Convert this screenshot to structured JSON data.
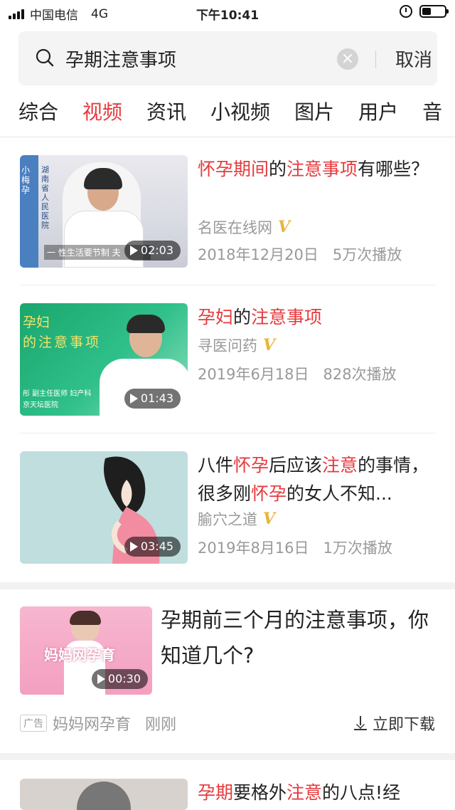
{
  "status_bar": {
    "carrier": "中国电信",
    "network": "4G",
    "time": "下午10:41"
  },
  "search": {
    "query": "孕期注意事项",
    "clear_symbol": "×",
    "cancel_label": "取消"
  },
  "tabs": [
    {
      "label": "综合"
    },
    {
      "label": "视频",
      "active": true
    },
    {
      "label": "资讯"
    },
    {
      "label": "小视频"
    },
    {
      "label": "图片"
    },
    {
      "label": "用户"
    },
    {
      "label": "音"
    }
  ],
  "results": [
    {
      "title_parts": [
        {
          "text": "怀孕期间",
          "hl": true
        },
        {
          "text": "的",
          "hl": false
        },
        {
          "text": "注意事项",
          "hl": true
        },
        {
          "text": "有哪些？",
          "hl": false
        }
      ],
      "source": "名医在线网",
      "verified": "V",
      "date": "2018年12月20日",
      "plays": "5万次播放",
      "duration": "02:03",
      "thumb_caption": "一 性生活要节制 夫",
      "thumb_side_text": "湖南省人民医院",
      "thumb_side_text2": "小梅孕"
    },
    {
      "title_parts": [
        {
          "text": "孕妇",
          "hl": true
        },
        {
          "text": "的",
          "hl": false
        },
        {
          "text": "注意事项",
          "hl": true
        }
      ],
      "source": "寻医问药",
      "verified": "V",
      "date": "2019年6月18日",
      "plays": "828次播放",
      "duration": "01:43",
      "thumb_text_1": "孕妇",
      "thumb_text_2": "的注意事项",
      "thumb_caption": "彤 副主任医师 妇产科",
      "thumb_caption_2": "京天坛医院"
    },
    {
      "title_parts": [
        {
          "text": "八件",
          "hl": false
        },
        {
          "text": "怀孕",
          "hl": true
        },
        {
          "text": "后应该",
          "hl": false
        },
        {
          "text": "注意",
          "hl": true
        },
        {
          "text": "的事情，很多刚",
          "hl": false
        },
        {
          "text": "怀孕",
          "hl": true
        },
        {
          "text": "的女人不知...",
          "hl": false
        }
      ],
      "source": "腧穴之道",
      "verified": "V",
      "date": "2019年8月16日",
      "plays": "1万次播放",
      "duration": "03:45"
    }
  ],
  "ad": {
    "title": "孕期前三个月的注意事项，你知道几个?",
    "duration": "00:30",
    "thumb_text": "妈妈网孕育",
    "tag": "广告",
    "source": "妈妈网孕育",
    "time": "刚刚",
    "download_label": "立即下载"
  },
  "next_result": {
    "title_parts": [
      {
        "text": "孕期",
        "hl": true
      },
      {
        "text": "要格外",
        "hl": false
      },
      {
        "text": "注意",
        "hl": true
      },
      {
        "text": "的八点!经",
        "hl": false
      }
    ]
  },
  "colors": {
    "highlight": "#e6393d",
    "verified": "#e9b53a",
    "muted": "#999999"
  }
}
